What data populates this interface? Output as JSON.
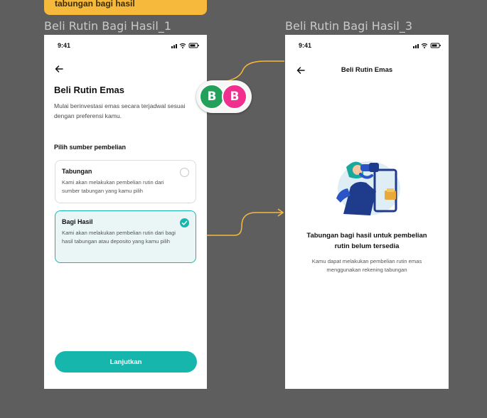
{
  "note": {
    "text": "tabungan bagi hasil"
  },
  "frames": {
    "left_title": "Beli Rutin Bagi Hasil_1",
    "right_title": "Beli Rutin Bagi Hasil_3"
  },
  "screen1": {
    "time": "9:41",
    "heading": "Beli Rutin Emas",
    "description": "Mulai berinvestasi emas secara terjadwal sesuai dengan preferensi kamu.",
    "source_label": "Pilih sumber pembelian",
    "options": [
      {
        "title": "Tabungan",
        "description": "Kami akan melakukan pembelian rutin dari sumber tabungan yang kamu pilih",
        "selected": false
      },
      {
        "title": "Bagi Hasil",
        "description": "Kami akan melakukan pembelian rutin dari bagi hasil tabungan atau deposito yang kamu pilih",
        "selected": true
      }
    ],
    "cta": "Lanjutkan"
  },
  "screen2": {
    "time": "9:41",
    "title": "Beli Rutin Emas",
    "empty_title": "Tabungan bagi hasil untuk pembelian rutin belum tersedia",
    "empty_desc": "Kamu dapat melakukan pembelian rutin emas menggunakan rekening tabungan"
  },
  "collaborators": [
    {
      "initial": "B",
      "color": "#23a15a"
    },
    {
      "initial": "B",
      "color": "#f02f8f"
    }
  ],
  "colors": {
    "accent": "#17b6ac",
    "connector": "#f6b93b",
    "canvas": "#5e5e5e"
  },
  "icons": [
    "back-arrow-icon",
    "signal-icon",
    "wifi-icon",
    "battery-icon",
    "check-icon"
  ]
}
